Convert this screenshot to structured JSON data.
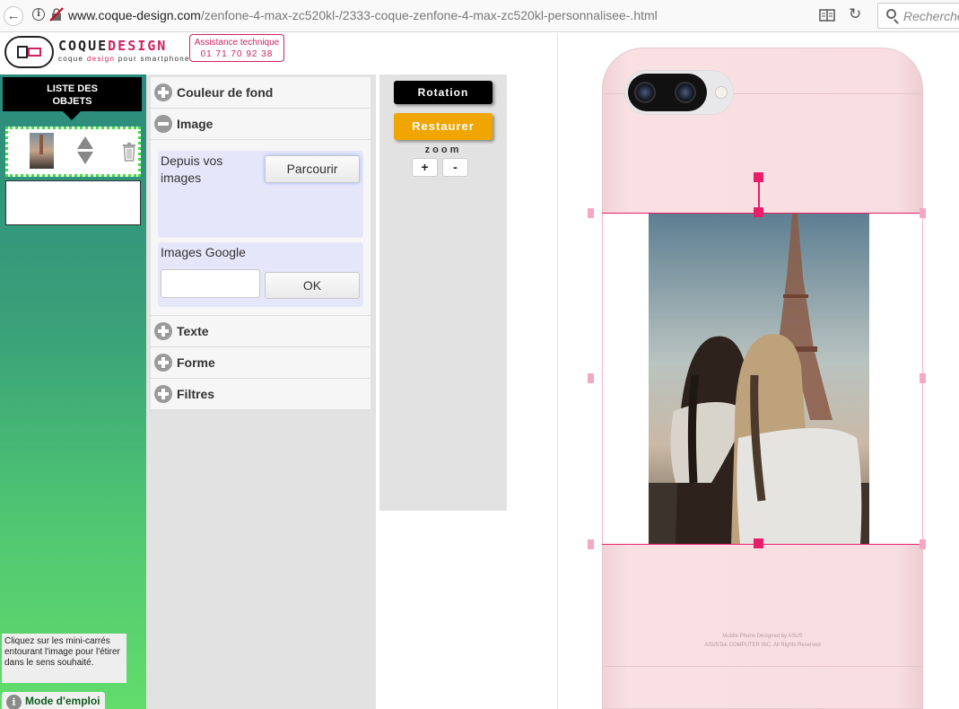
{
  "browser": {
    "url_domain": "www.coque-design.com",
    "url_path": "/zenfone-4-max-zc520kl-/2333-coque-zenfone-4-max-zc520kl-personnalisee-.html",
    "search_placeholder": "Recherche"
  },
  "header": {
    "logo_word_a": "COQUE",
    "logo_word_b": "DESIGN",
    "logo_tag_a": "coque ",
    "logo_tag_b": "design",
    "logo_tag_c": " pour smartphone",
    "assist_title": "Assistance technique",
    "assist_phone": "01 71 70 92 38"
  },
  "sidebar": {
    "objects_title_line1": "LISTE DES",
    "objects_title_line2": "OBJETS",
    "hint": "Cliquez sur les mini-carrés entourant l'image pour l'étirer dans le sens souhaité.",
    "mode_label": "Mode d'emploi",
    "mode_icon": "i"
  },
  "panel": {
    "sections": [
      {
        "label": "Couleur de fond",
        "state": "collapsed"
      },
      {
        "label": "Image",
        "state": "expanded"
      },
      {
        "label": "Texte",
        "state": "collapsed"
      },
      {
        "label": "Forme",
        "state": "collapsed"
      },
      {
        "label": "Filtres",
        "state": "collapsed"
      }
    ],
    "image": {
      "upload_label": "Depuis vos images",
      "browse_button": "Parcourir",
      "google_label": "Images Google",
      "google_input_value": "",
      "ok_button": "OK"
    }
  },
  "tools": {
    "rotation": "Rotation",
    "restore": "Restaurer",
    "zoom_label": "zoom",
    "zoom_in": "+",
    "zoom_out": "-"
  },
  "phone": {
    "fine_line1": "Mobile Phone Designed by ASUS",
    "fine_line2": "ASUSTek COMPUTER INC. All Rights Reserved"
  },
  "colors": {
    "accent_pink": "#e81e6a",
    "restore_orange": "#f0a500",
    "sidebar_top": "#2a8a7c",
    "sidebar_bottom": "#62dc6b",
    "phone_pink": "#f8dee2"
  }
}
